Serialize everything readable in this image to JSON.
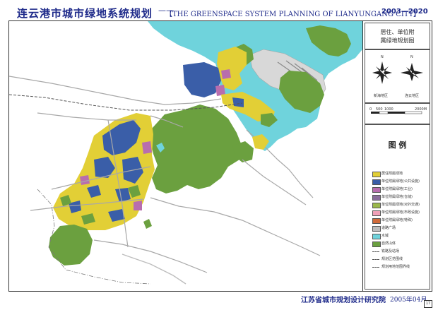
{
  "title": {
    "cn": "连云港市城市绿地系统规划",
    "dash": "——",
    "en": "【THE GREENSPACE SYSTEM PLANNING OF LIANYUNGANG CITY】",
    "years": "2003—2020"
  },
  "map": {
    "colors": {
      "sea": "#6fd3dc",
      "green": "#6ba03f",
      "blue": "#3a5ea8",
      "yellow": "#e2cf36",
      "purple": "#b86dae",
      "pink": "#f0a0b8",
      "road": "#a8a8a8",
      "gray": "#d8d8d8"
    }
  },
  "panel": {
    "title_line1": "居住、单位附",
    "title_line2": "属绿地规划图",
    "north_label": "N",
    "rose_left_label": "新海地区",
    "rose_right_label": "连云地区",
    "scale_ticks": [
      "0",
      "500",
      "1000",
      "2000M"
    ],
    "legend_title": "图 例",
    "legend": [
      {
        "label": "居住附属绿地",
        "color": "#e2cf36"
      },
      {
        "label": "单位附属绿地(公共设施)",
        "color": "#3a5ea8"
      },
      {
        "label": "单位附属绿地(工业)",
        "color": "#b86dae"
      },
      {
        "label": "单位附属绿地(仓储)",
        "color": "#8a6d9a"
      },
      {
        "label": "单位附属绿地(对外交通)",
        "color": "#9ab84a"
      },
      {
        "label": "单位附属绿地(市政设施)",
        "color": "#f0a0b8"
      },
      {
        "label": "单位附属绿地(特殊)",
        "color": "#d06a3a"
      },
      {
        "label": "道路广场",
        "color": "#bdbdbd"
      },
      {
        "label": "水域",
        "color": "#6fd3dc"
      },
      {
        "label": "自然山体",
        "color": "#6ba03f"
      },
      {
        "label": "铁路及站场",
        "color": "#ffffff"
      },
      {
        "label": "规划区范围线",
        "color": "#ffffff"
      },
      {
        "label": "规划用地范围界线",
        "color": "#ffffff"
      }
    ]
  },
  "footer": {
    "institute": "江苏省城市规划设计研究院",
    "date": "2005年04月"
  },
  "page_number": "17"
}
